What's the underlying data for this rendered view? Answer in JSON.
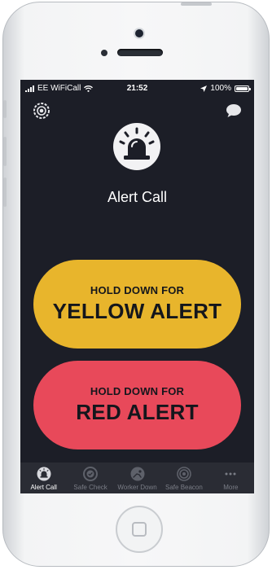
{
  "status_bar": {
    "carrier": "EE WiFiCall",
    "time": "21:52",
    "battery": "100%"
  },
  "header": {
    "settings_icon": "settings-target-icon",
    "chat_icon": "chat-bubble-icon",
    "main_icon": "alarm-bell-icon",
    "title": "Alert Call"
  },
  "yellow_alert": {
    "hold_text": "HOLD DOWN FOR",
    "label": "YELLOW ALERT",
    "color": "#e8b52c"
  },
  "red_alert": {
    "hold_text": "HOLD DOWN FOR",
    "label": "RED ALERT",
    "color": "#e8495a"
  },
  "tabs": [
    {
      "label": "Alert Call",
      "icon": "alarm-icon",
      "active": true
    },
    {
      "label": "Safe Check",
      "icon": "check-circle-icon",
      "active": false
    },
    {
      "label": "Worker Down",
      "icon": "worker-down-icon",
      "active": false
    },
    {
      "label": "Safe Beacon",
      "icon": "beacon-icon",
      "active": false
    },
    {
      "label": "More",
      "icon": "more-dots-icon",
      "active": false
    }
  ]
}
